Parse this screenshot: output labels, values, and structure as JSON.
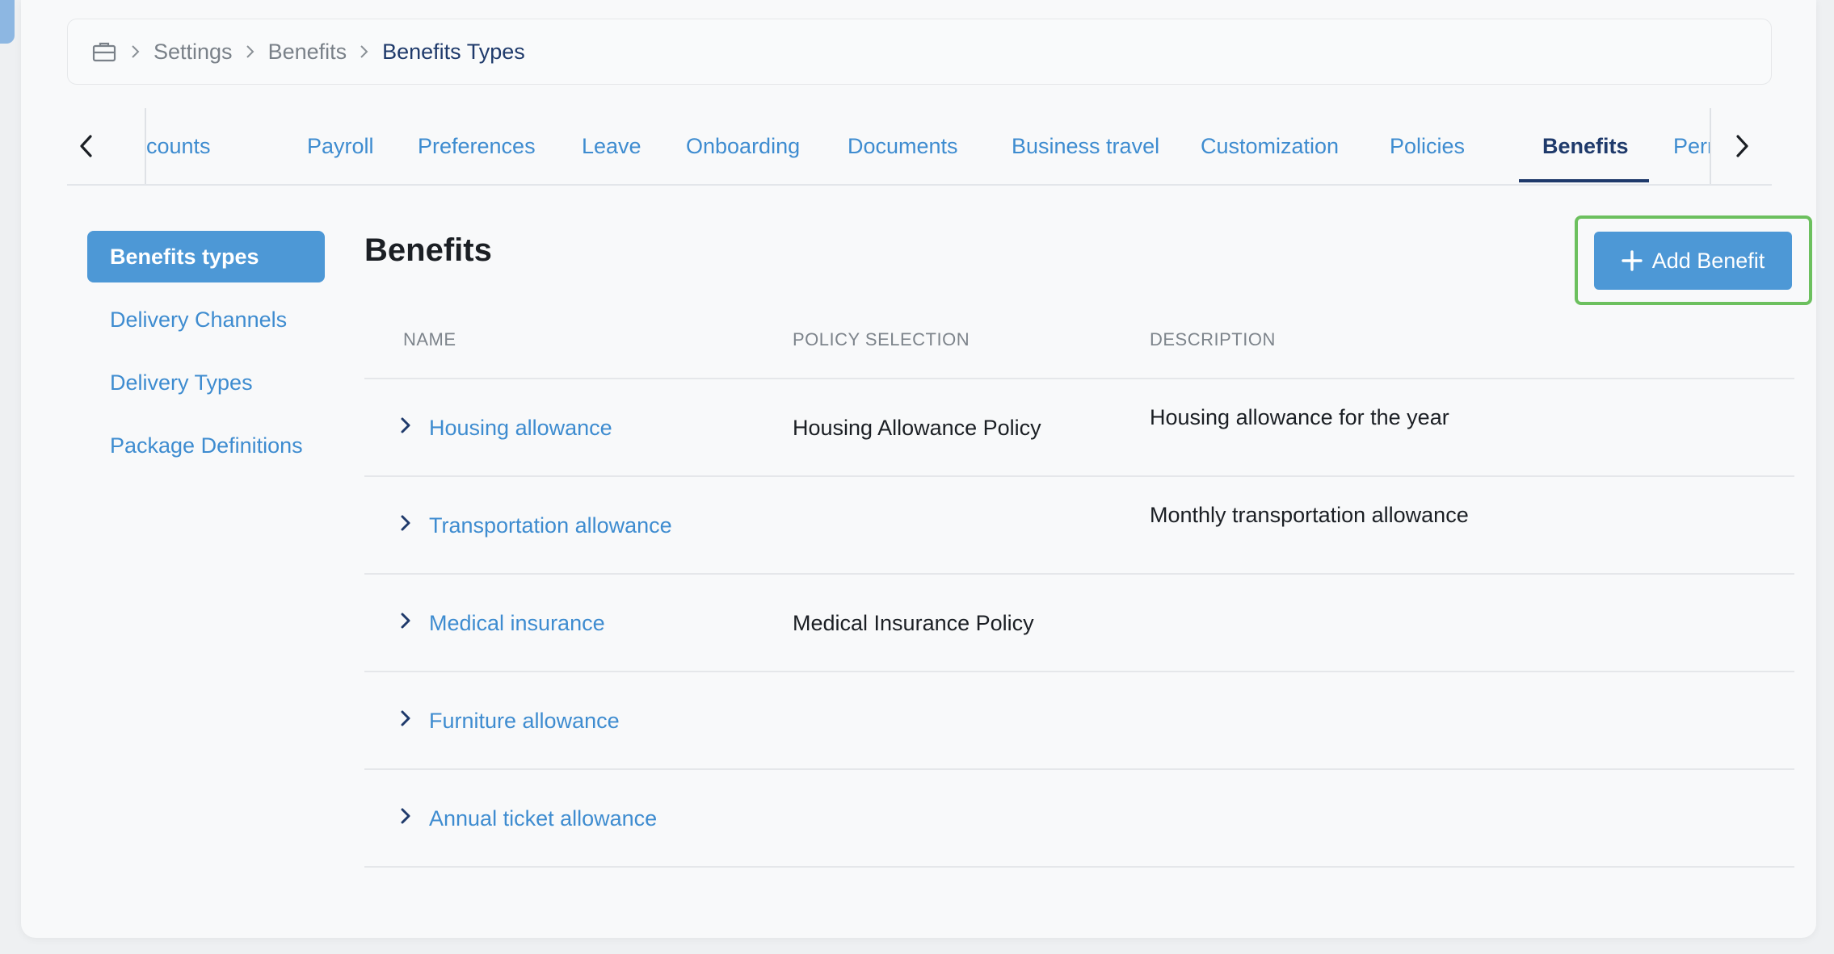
{
  "breadcrumb": {
    "items": [
      "Settings",
      "Benefits"
    ],
    "current": "Benefits Types"
  },
  "tabs": [
    {
      "label": "counts"
    },
    {
      "label": "Payroll"
    },
    {
      "label": "Preferences"
    },
    {
      "label": "Leave"
    },
    {
      "label": "Onboarding"
    },
    {
      "label": "Documents"
    },
    {
      "label": "Business travel"
    },
    {
      "label": "Customization"
    },
    {
      "label": "Policies"
    },
    {
      "label": "Benefits"
    },
    {
      "label": "Permissions"
    }
  ],
  "active_tab": "Benefits",
  "sidemenu": {
    "items": [
      "Benefits types",
      "Delivery Channels",
      "Delivery Types",
      "Package Definitions"
    ],
    "active": "Benefits types"
  },
  "main": {
    "title": "Benefits",
    "add_button": "Add Benefit"
  },
  "table": {
    "headers": [
      "NAME",
      "POLICY SELECTION",
      "DESCRIPTION"
    ],
    "rows": [
      {
        "name": "Housing allowance",
        "policy": "Housing Allowance Policy",
        "description": "Housing allowance for the year"
      },
      {
        "name": "Transportation allowance",
        "policy": "",
        "description": "Monthly transportation allowance"
      },
      {
        "name": "Medical insurance",
        "policy": "Medical Insurance Policy",
        "description": ""
      },
      {
        "name": "Furniture allowance",
        "policy": "",
        "description": ""
      },
      {
        "name": "Annual ticket allowance",
        "policy": "",
        "description": ""
      }
    ]
  },
  "colors": {
    "accent": "#4d98d6",
    "link": "#3e8cd0",
    "active_nav": "#1f3a6b",
    "highlight_border": "#6cc05e"
  }
}
